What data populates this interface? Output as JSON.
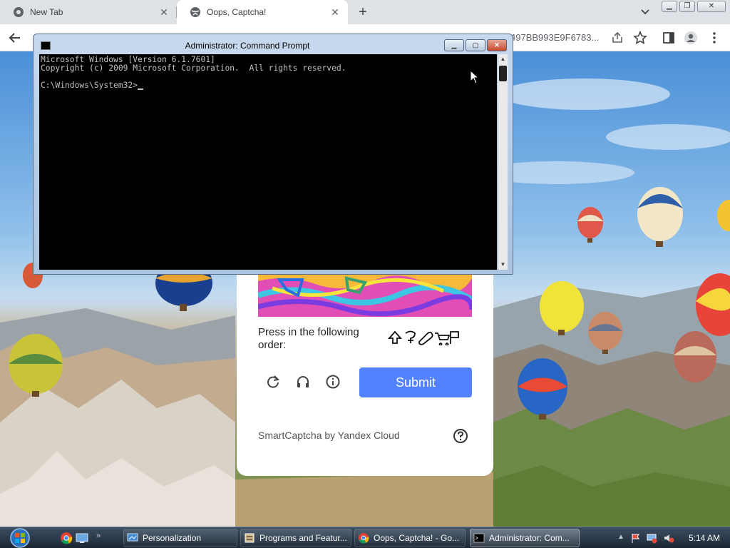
{
  "browser": {
    "tabs": [
      {
        "label": "New Tab",
        "active": false
      },
      {
        "label": "Oops, Captcha!",
        "active": true
      }
    ],
    "url_fragment": "497BB993E9F6783..."
  },
  "captcha": {
    "instruction": "Press in the following order:",
    "submit_label": "Submit",
    "brand": "SmartCaptcha by Yandex Cloud",
    "accent_color": "#5282ff"
  },
  "cmd": {
    "title": "Administrator:  Command Prompt",
    "lines": [
      "Microsoft Windows [Version 6.1.7601]",
      "Copyright (c) 2009 Microsoft Corporation.  All rights reserved.",
      "",
      "C:\\Windows\\System32>"
    ]
  },
  "taskbar": {
    "tasks": [
      {
        "label": "Personalization"
      },
      {
        "label": "Programs and Featur..."
      },
      {
        "label": "Oops, Captcha! - Go..."
      },
      {
        "label": "Administrator:  Com..."
      }
    ],
    "clock": "5:14 AM"
  }
}
